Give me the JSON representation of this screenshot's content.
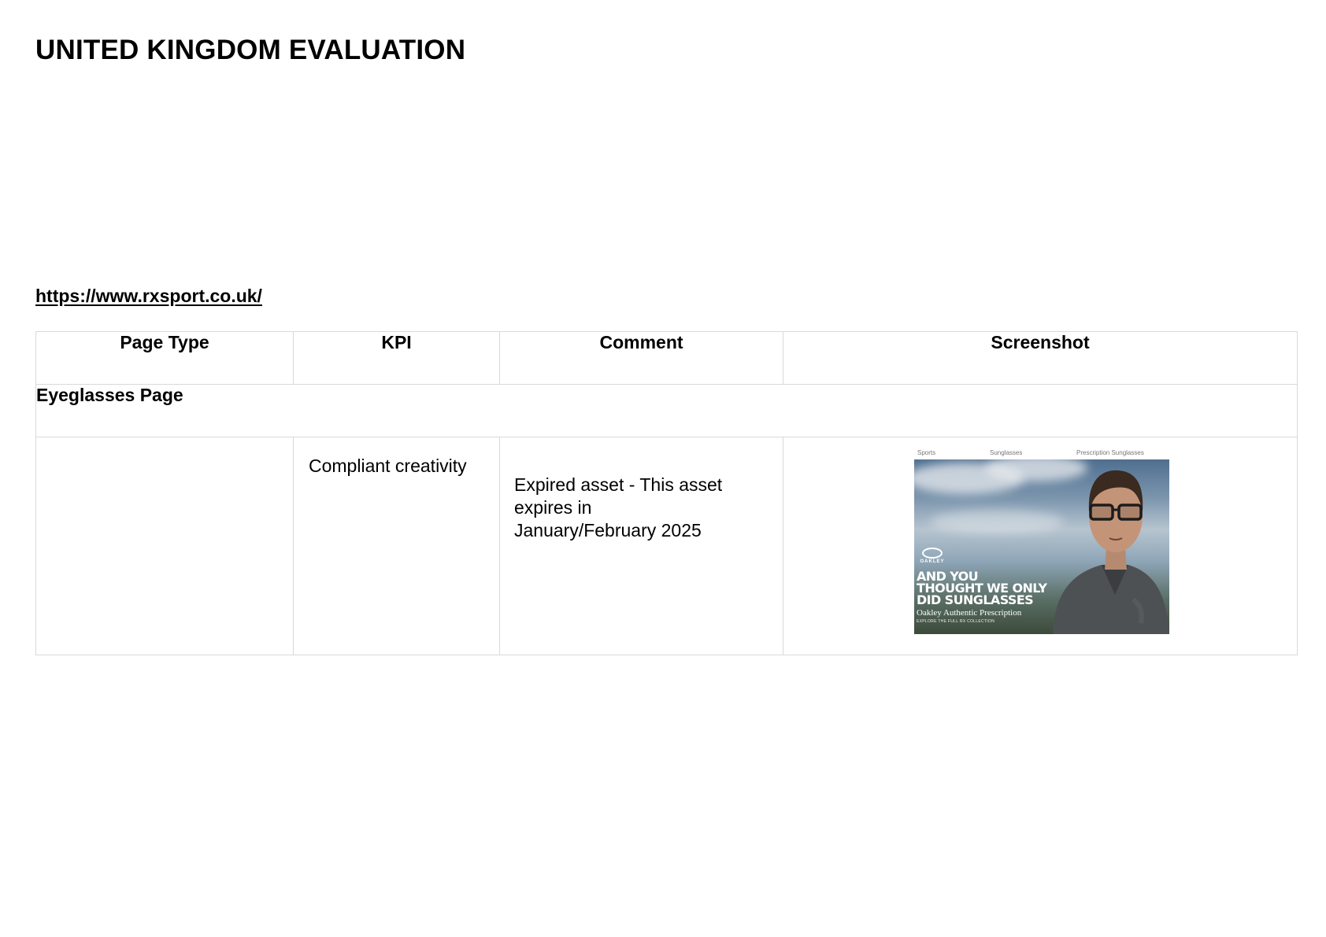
{
  "page": {
    "title": "UNITED KINGDOM EVALUATION",
    "link": "https://www.rxsport.co.uk/"
  },
  "table": {
    "headers": [
      "Page Type",
      "KPI",
      "Comment",
      "Screenshot"
    ],
    "section_title": "Eyeglasses Page",
    "rows": [
      {
        "page_type": "",
        "kpi": "Compliant creativity",
        "comment": "Expired asset - This asset expires in January/February 2025"
      }
    ]
  },
  "screenshot": {
    "nav": [
      "Sports",
      "Sunglasses",
      "Prescription Sunglasses"
    ],
    "brand_logo": "oakley-logo",
    "headline_lines": [
      "AND YOU",
      "THOUGHT WE ONLY",
      "DID SUNGLASSES"
    ],
    "subhead": "Oakley Authentic Prescription",
    "tagline": "EXPLORE THE FULL RX COLLECTION"
  },
  "colors": {
    "table_border": "#d9d9d9",
    "text": "#000000",
    "headline_text": "#ffffff"
  }
}
